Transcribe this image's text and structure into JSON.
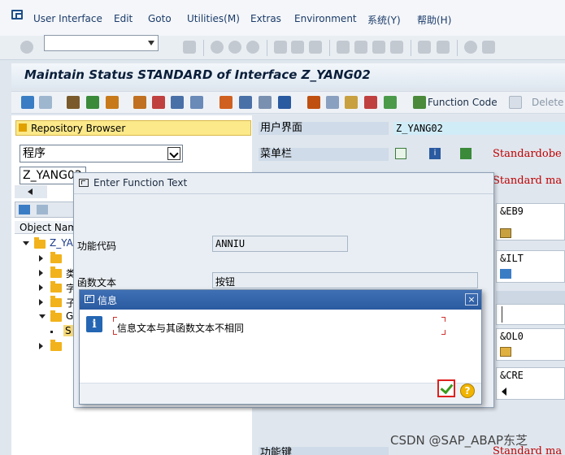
{
  "menubar": {
    "items": [
      "User Interface",
      "Edit",
      "Goto",
      "Utilities(M)",
      "Extras",
      "Environment",
      "系统(Y)",
      "帮助(H)"
    ]
  },
  "title": "Maintain Status STANDARD of Interface Z_YANG02",
  "app_toolbar": {
    "function_code_label": "Function Code",
    "delete_label": "Delete"
  },
  "left_pane": {
    "repo_browser_label": "Repository Browser",
    "object_type": "程序",
    "object_name": "Z_YANG02",
    "tree_header": "Object Nam",
    "tree_rows": [
      "Z_YA",
      "类",
      "字",
      "子",
      "G",
      "S"
    ]
  },
  "right_pane": {
    "user_interface_label": "用户界面",
    "user_interface_value": "Z_YANG02",
    "menubar_label": "菜单栏",
    "menubar_value": "Standardobe",
    "standard_value": "Standard ma",
    "function_key_label": "功能键",
    "function_key_value": "Standard ma",
    "codes": [
      "&EB9",
      "&ILT",
      "&OL0",
      "&CRE"
    ]
  },
  "dialog_function_text": {
    "title": "Enter Function Text",
    "function_code_label": "功能代码",
    "function_code_value": "ANNIU",
    "function_text_label": "函数文本",
    "function_text_value": "按钮"
  },
  "dialog_info": {
    "title": "信息",
    "message": "信息文本与其函数文本不相同",
    "close_label": "×"
  },
  "watermark": "CSDN @SAP_ABAP东芝"
}
